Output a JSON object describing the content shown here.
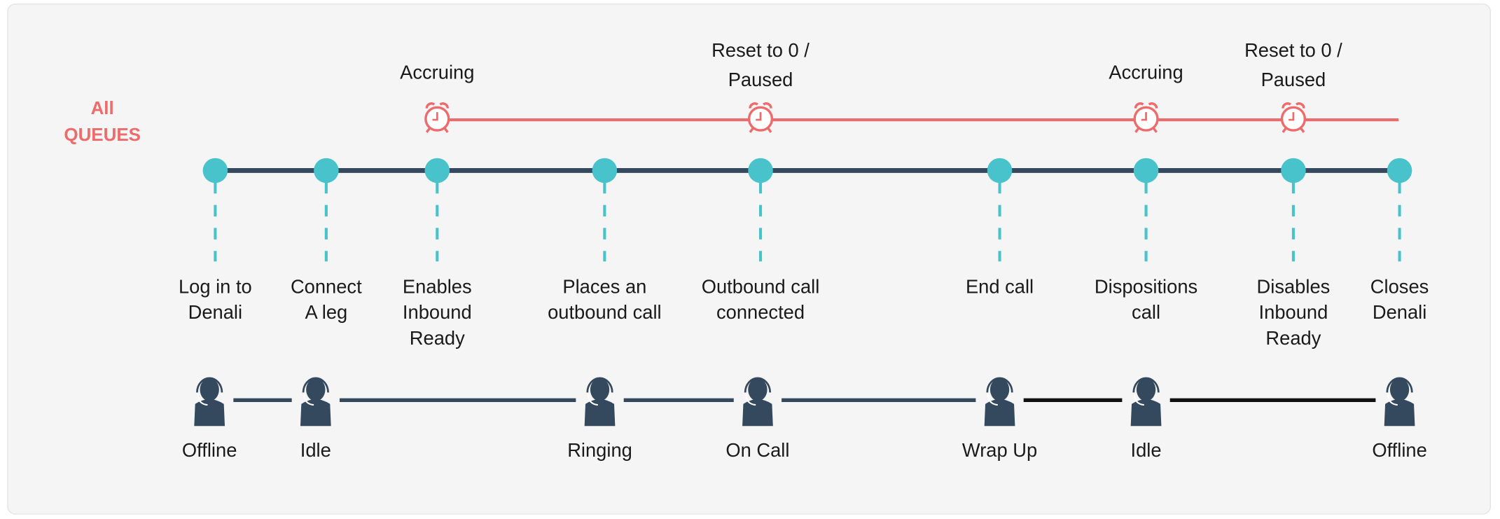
{
  "colors": {
    "queue": "#ee6b6b",
    "timeline": "#34495e",
    "milestone": "#48c3cc",
    "agent": "#34495e",
    "agent_line_active": "#111111",
    "background": "#f5f5f5"
  },
  "queue_label": [
    "All",
    "QUEUES"
  ],
  "queue_events": [
    {
      "label": [
        "Accruing"
      ],
      "icon": "alarm-clock-icon"
    },
    {
      "label": [
        "Reset to 0 /",
        "Paused"
      ],
      "icon": "alarm-clock-icon"
    },
    {
      "label": [
        "Accruing"
      ],
      "icon": "alarm-clock-icon"
    },
    {
      "label": [
        "Reset to 0 /",
        "Paused"
      ],
      "icon": "alarm-clock-icon"
    }
  ],
  "milestones": [
    {
      "label": [
        "Log in to",
        "Denali"
      ]
    },
    {
      "label": [
        "Connect",
        "A leg"
      ]
    },
    {
      "label": [
        "Enables",
        "Inbound",
        "Ready"
      ]
    },
    {
      "label": [
        "Places an",
        "outbound call"
      ]
    },
    {
      "label": [
        "Outbound call",
        "connected"
      ]
    },
    {
      "label": [
        "End call"
      ]
    },
    {
      "label": [
        "Dispositions",
        "call"
      ]
    },
    {
      "label": [
        "Disables",
        "Inbound",
        "Ready"
      ]
    },
    {
      "label": [
        "Closes",
        "Denali"
      ]
    }
  ],
  "agent_states": [
    {
      "label": "Offline",
      "icon": "agent-headset-icon"
    },
    {
      "label": "Idle",
      "icon": "agent-headset-icon"
    },
    {
      "label": "Ringing",
      "icon": "agent-headset-icon"
    },
    {
      "label": "On Call",
      "icon": "agent-headset-icon"
    },
    {
      "label": "Wrap Up",
      "icon": "agent-headset-icon"
    },
    {
      "label": "Idle",
      "icon": "agent-headset-icon"
    },
    {
      "label": "Offline",
      "icon": "agent-headset-icon"
    }
  ]
}
